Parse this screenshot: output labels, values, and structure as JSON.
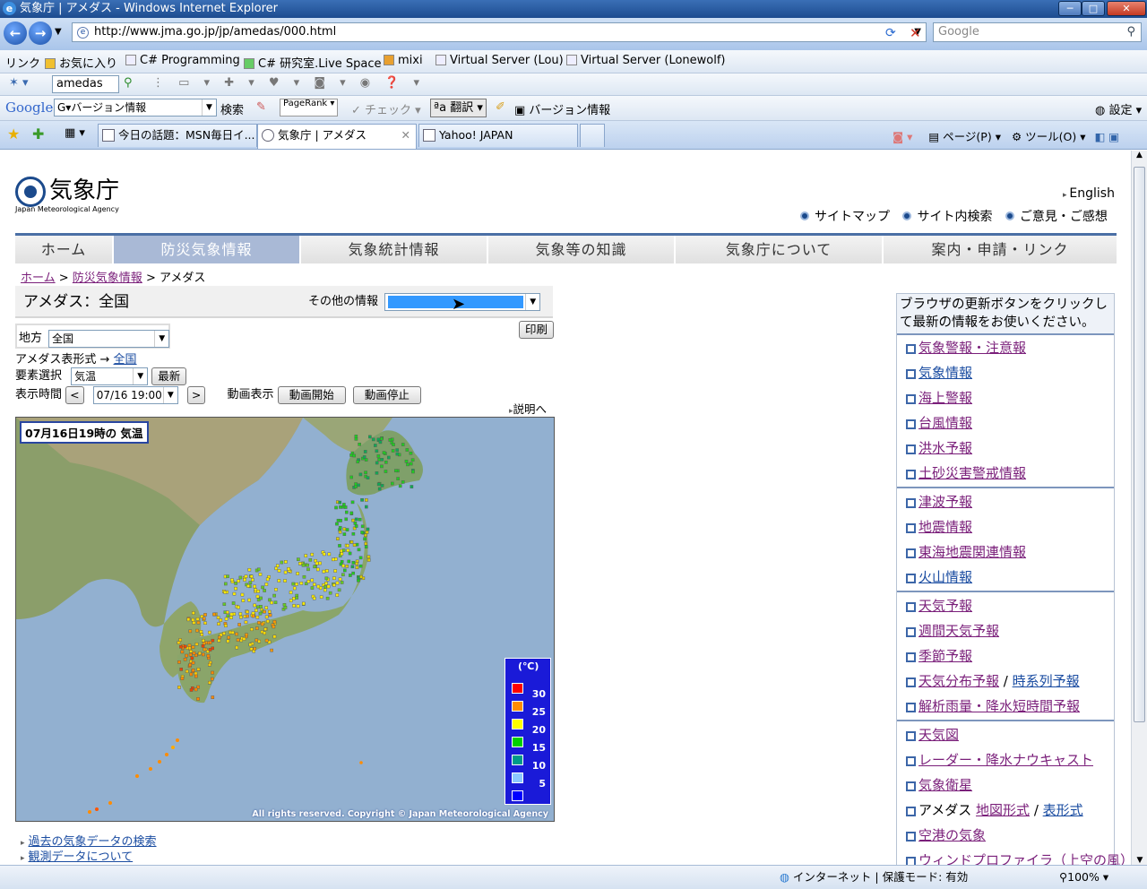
{
  "window": {
    "title": "気象庁 | アメダス - Windows Internet Explorer"
  },
  "address": {
    "url": "http://www.jma.go.jp/jp/amedas/000.html",
    "search_placeholder": "Google"
  },
  "links_bar": {
    "label": "リンク",
    "items": [
      "お気に入り",
      "C# Programming",
      "研究室.Live Space",
      "mixi",
      "Virtual Server (Lou)",
      "Virtual Server (Lonewolf)"
    ]
  },
  "toolbar": {
    "search_value": "amedas"
  },
  "google_bar": {
    "brand": "Google",
    "query": "バージョン情報",
    "search": "検索",
    "pagerank": "PageRank",
    "check": "チェック",
    "translate": "翻訳",
    "version": "バージョン情報",
    "settings": "設定"
  },
  "tabs": [
    {
      "label": "今日の話題：MSN毎日イ..."
    },
    {
      "label": "気象庁 | アメダス"
    },
    {
      "label": "Yahoo! JAPAN"
    }
  ],
  "cmd": {
    "page": "ページ(P)",
    "tools": "ツール(O)"
  },
  "site": {
    "logo": "気象庁",
    "logo_sub": "Japan Meteorological Agency",
    "english": "English",
    "sitemap": "サイトマップ",
    "search": "サイト内検索",
    "feedback": "ご意見・ご感想",
    "nav": [
      "ホーム",
      "防災気象情報",
      "気象統計情報",
      "気象等の知識",
      "気象庁について",
      "案内・申請・リンク"
    ],
    "breadcrumb": {
      "home": "ホーム",
      "sep": " > ",
      "disaster": "防災気象情報",
      "current": "アメダス"
    },
    "page_title": "アメダス：全国",
    "other_info": "その他の情報",
    "print": "印刷",
    "region_label": "地方",
    "region_value": "全国",
    "table_format": "アメダス表形式 →",
    "table_format_link": "全国",
    "element_label": "要素選択",
    "element_value": "気温",
    "latest": "最新",
    "time_label": "表示時間",
    "prev": "<",
    "time_value": "07/16 19:00",
    "next": ">",
    "anim_label": "動画表示",
    "anim_start": "動画開始",
    "anim_stop": "動画停止",
    "explain": "説明へ",
    "map_title": "07月16日19時の 気温",
    "legend_unit": "(℃)",
    "copyright": "All rights reserved. Copyright © Japan Meteorological Agency",
    "bottom_links": [
      "過去の気象データの検索",
      "観測データについて"
    ]
  },
  "legend": [
    {
      "value": "30",
      "color": "#ff0000"
    },
    {
      "value": "25",
      "color": "#ff8c00"
    },
    {
      "value": "20",
      "color": "#ffff00"
    },
    {
      "value": "15",
      "color": "#00d000"
    },
    {
      "value": "10",
      "color": "#009a8a"
    },
    {
      "value": "5",
      "color": "#8cc8ff"
    },
    {
      "value": "",
      "color": "#0000ff"
    }
  ],
  "sidebar": {
    "message": "ブラウザの更新ボタンをクリックして最新の情報をお使いください。",
    "items": [
      "気象警報・注意報",
      "気象情報",
      "海上警報",
      "台風情報",
      "洪水予報",
      "土砂災害警戒情報",
      "津波予報",
      "地震情報",
      "東海地震関連情報",
      "火山情報",
      "天気予報",
      "週間天気予報",
      "季節予報",
      "天気分布予報",
      "時系列予報",
      "解析雨量・降水短時間予報",
      "天気図",
      "レーダー・降水ナウキャスト",
      "気象衛星",
      "アメダス",
      "地図形式",
      "表形式",
      "空港の気象",
      "ウィンドプロファイラ（上空の風）"
    ]
  },
  "status": {
    "zone": "インターネット | 保護モード: 有効",
    "zoom": "100%"
  }
}
